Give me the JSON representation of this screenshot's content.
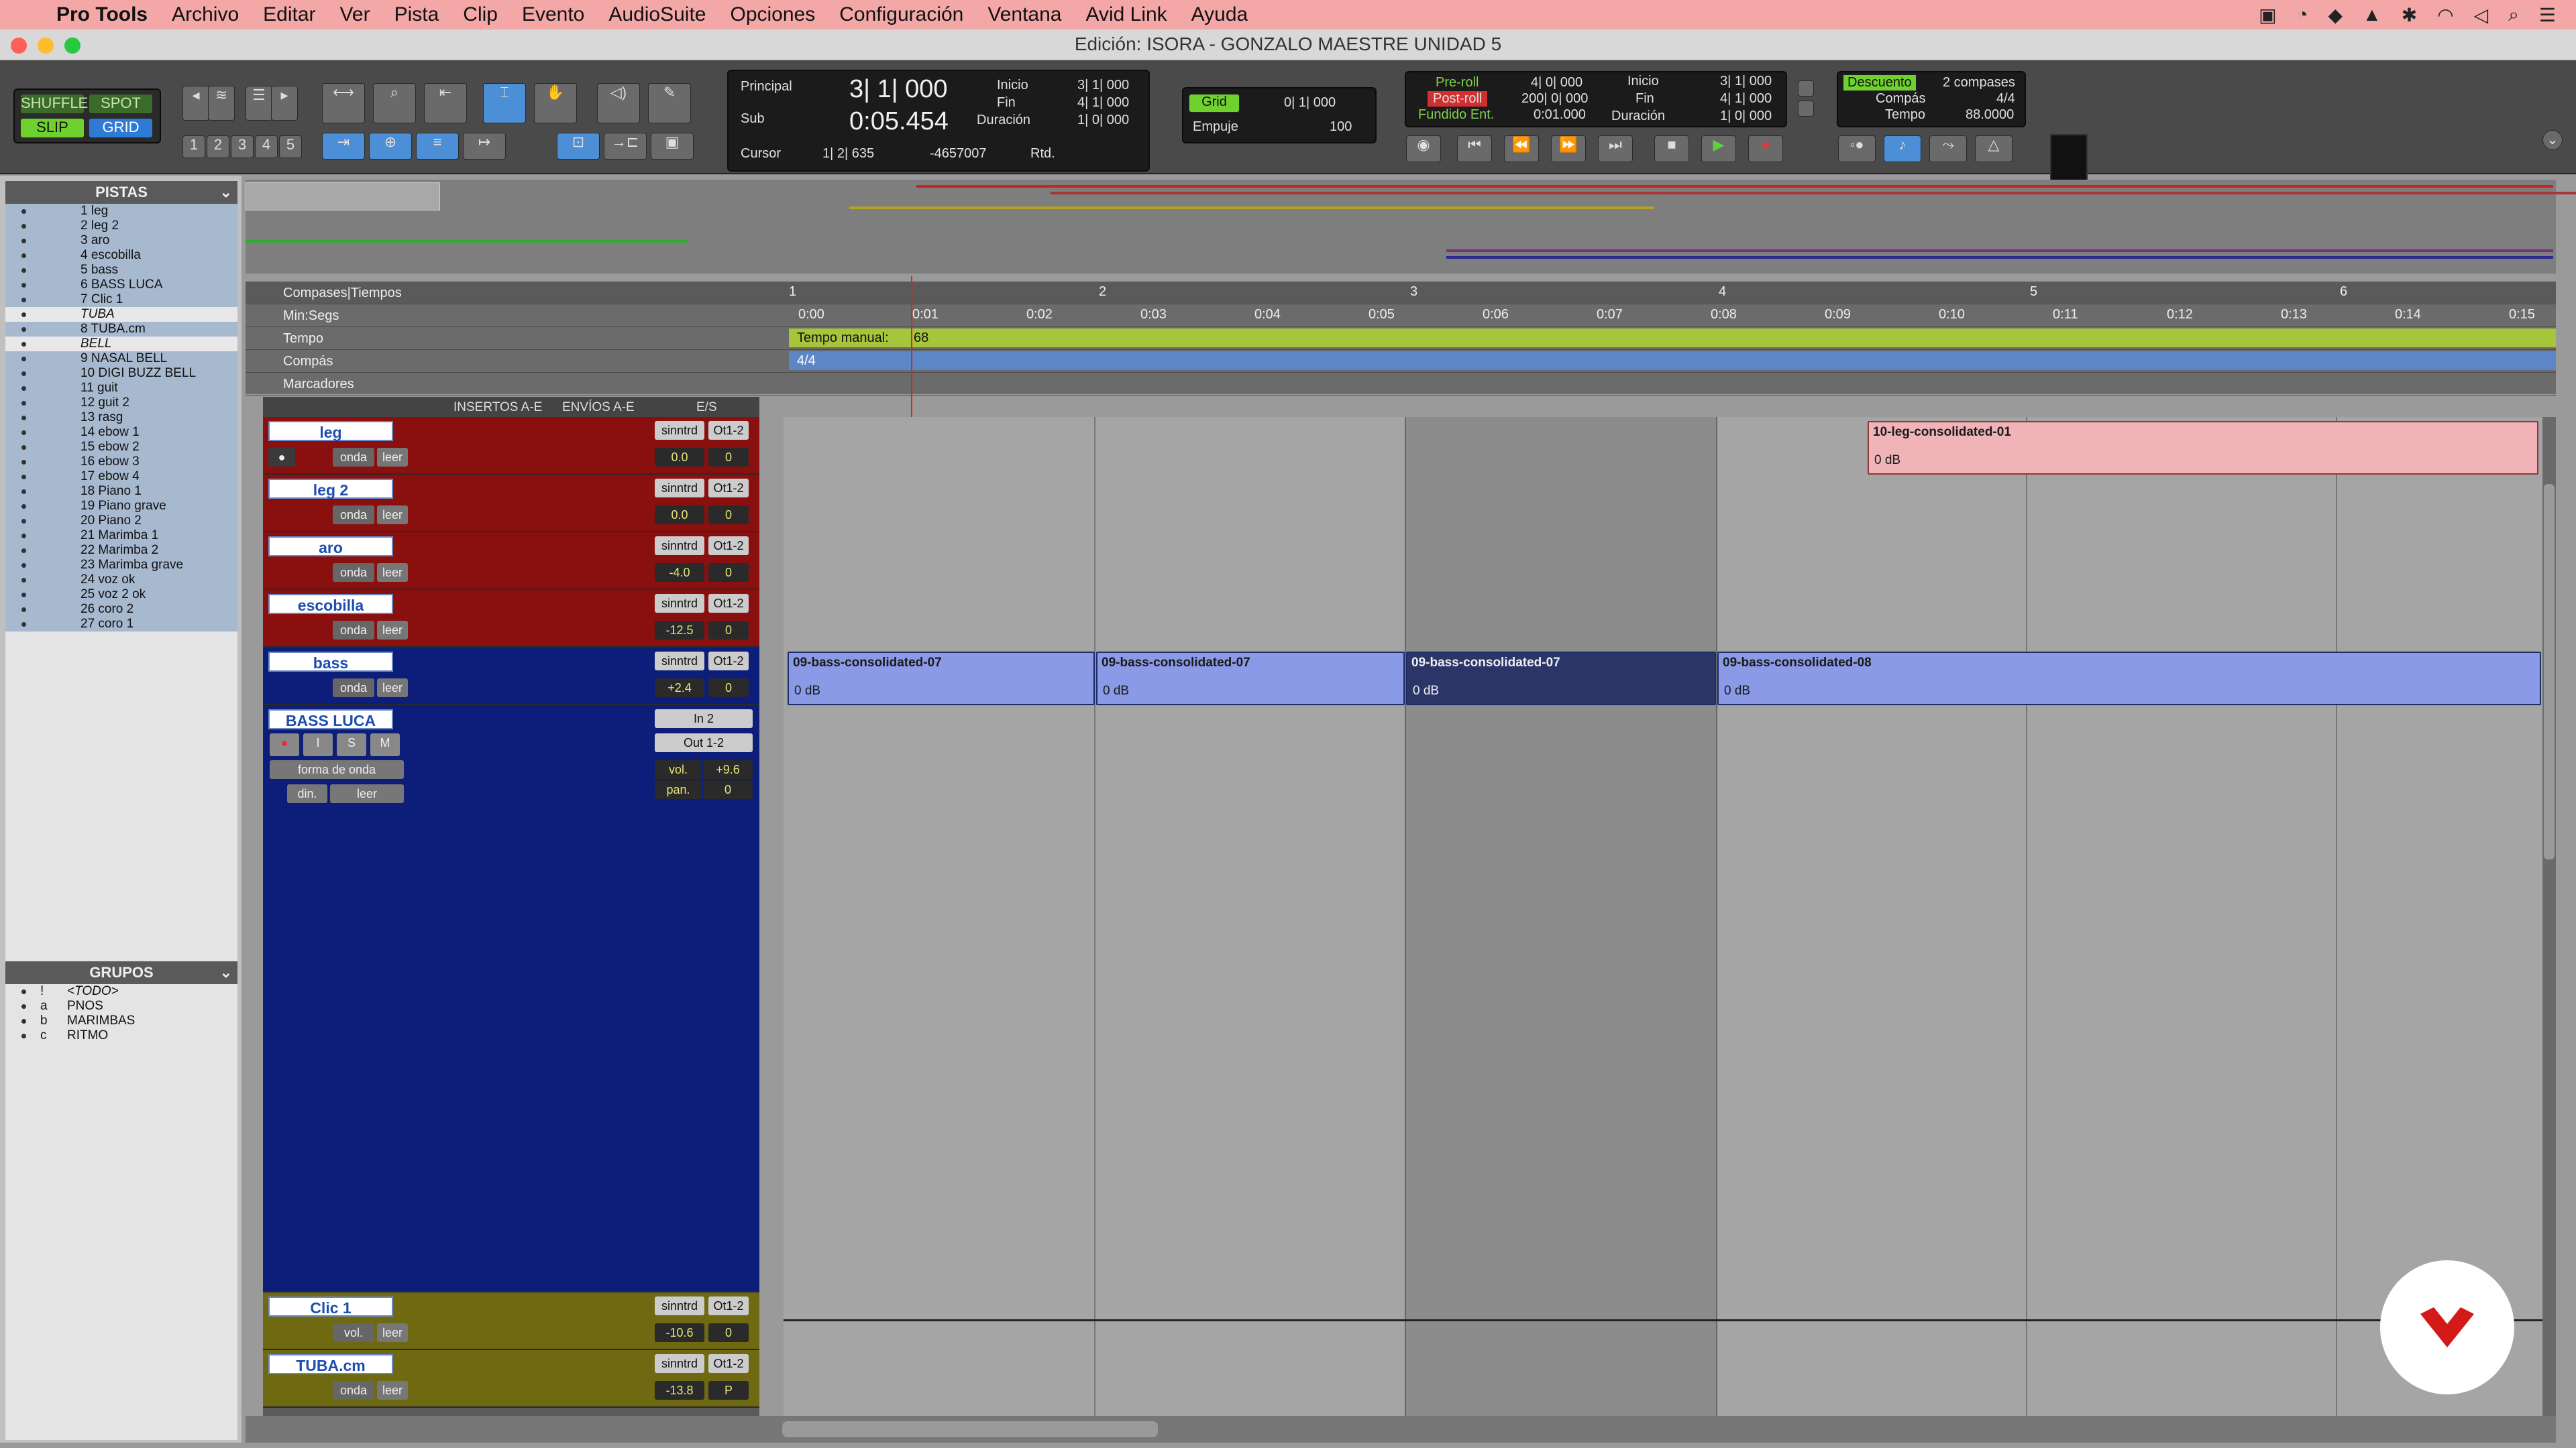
{
  "menubar": {
    "app": "Pro Tools",
    "items": [
      "Archivo",
      "Editar",
      "Ver",
      "Pista",
      "Clip",
      "Evento",
      "AudioSuite",
      "Opciones",
      "Configuración",
      "Ventana",
      "Avid Link",
      "Ayuda"
    ]
  },
  "window": {
    "title": "Edición: ISORA - GONZALO MAESTRE UNIDAD 5"
  },
  "edit_modes": {
    "shuffle": "SHUFFLE",
    "spot": "SPOT",
    "slip": "SLIP",
    "grid": "GRID"
  },
  "zoom_presets": [
    "1",
    "2",
    "3",
    "4",
    "5"
  ],
  "counter": {
    "principal_label": "Principal",
    "principal_value": "3| 1| 000",
    "sub_label": "Sub",
    "sub_value": "0:05.454",
    "inicio_label": "Inicio",
    "inicio_value": "3| 1| 000",
    "fin_label": "Fin",
    "fin_value": "4| 1| 000",
    "duracion_label": "Duración",
    "duracion_value": "1| 0| 000",
    "cursor_label": "Cursor",
    "cursor_value": "1| 2| 635",
    "cursor_sample": "-4657007",
    "rtd": "Rtd."
  },
  "grid": {
    "label": "Grid",
    "value": "0| 1| 000",
    "nudge_label": "Empuje",
    "nudge_value": "100"
  },
  "transport_counter": {
    "preroll_label": "Pre-roll",
    "preroll_value": "4| 0| 000",
    "postroll_label": "Post-roll",
    "postroll_value": "200| 0| 000",
    "fundido_label": "Fundido Ent.",
    "fundido_value": "0:01.000",
    "inicio_label": "Inicio",
    "inicio_value": "3| 1| 000",
    "fin_label": "Fin",
    "fin_value": "4| 1| 000",
    "duracion_label": "Duración",
    "duracion_value": "1| 0| 000"
  },
  "countoff": {
    "label": "Descuento",
    "value": "2 compases",
    "meter_label": "Compás",
    "meter_value": "4/4",
    "tempo_label": "Tempo",
    "tempo_value": "88.0000"
  },
  "tracks_panel": {
    "title": "PISTAS",
    "items": [
      "1 leg",
      "2 leg 2",
      "3 aro",
      "4 escobilla",
      "5 bass",
      "6 BASS LUCA",
      "7 Clic 1",
      "TUBA",
      "8 TUBA.cm",
      "BELL",
      "9 NASAL BELL",
      "10 DIGI BUZZ BELL",
      "11 guit",
      "12 guit 2",
      "13 rasg",
      "14 ebow 1",
      "15 ebow 2",
      "16 ebow 3",
      "17 ebow 4",
      "18 Piano 1",
      "19 Piano grave",
      "20 Piano 2",
      "21 Marimba 1",
      "22 Marimba 2",
      "23 Marimba grave",
      "24 voz ok",
      "25 voz 2 ok",
      "26 coro 2",
      "27 coro 1"
    ]
  },
  "groups_panel": {
    "title": "GRUPOS",
    "items": [
      {
        "id": "!",
        "name": "<TODO>"
      },
      {
        "id": "a",
        "name": "PNOS"
      },
      {
        "id": "b",
        "name": "MARIMBAS"
      },
      {
        "id": "c",
        "name": "RITMO"
      }
    ]
  },
  "rulers": {
    "bars_label": "Compases|Tiempos",
    "minsecs_label": "Min:Segs",
    "tempo_label": "Tempo",
    "meter_label": "Compás",
    "markers_label": "Marcadores",
    "tempo_text": "Tempo manual:",
    "tempo_value": "68",
    "meter_value": "4/4",
    "bars": [
      "1",
      "2",
      "3",
      "4",
      "5",
      "6"
    ],
    "times": [
      "0:00",
      "0:01",
      "0:02",
      "0:03",
      "0:04",
      "0:05",
      "0:06",
      "0:07",
      "0:08",
      "0:09",
      "0:10",
      "0:11",
      "0:12",
      "0:13",
      "0:14",
      "0:15"
    ]
  },
  "columns": {
    "inserts": "INSERTOS A-E",
    "sends": "ENVÍOS A-E",
    "io": "E/S"
  },
  "tracks": [
    {
      "name": "leg",
      "num": "1",
      "input": "sinntrd",
      "output": "Ot1-2",
      "vol": "0.0",
      "pan": "0"
    },
    {
      "name": "leg 2",
      "num": "2",
      "input": "sinntrd",
      "output": "Ot1-2",
      "vol": "0.0",
      "pan": "0"
    },
    {
      "name": "aro",
      "num": "3",
      "input": "sinntrd",
      "output": "Ot1-2",
      "vol": "-4.0",
      "pan": "0"
    },
    {
      "name": "escobilla",
      "num": "4",
      "input": "sinntrd",
      "output": "Ot1-2",
      "vol": "-12.5",
      "pan": "0"
    },
    {
      "name": "bass",
      "num": "5",
      "input": "sinntrd",
      "output": "Ot1-2",
      "vol": "+2.4",
      "pan": "0"
    },
    {
      "name": "BASS LUCA",
      "num": "6",
      "input": "In 2",
      "output": "Out 1-2",
      "vol_label": "vol.",
      "vol": "+9.6",
      "pan_label": "pan.",
      "pan": "0",
      "view": "forma de onda",
      "auto_label": "din.",
      "auto_mode": "leer"
    },
    {
      "name": "Clic 1",
      "num": "7",
      "input": "sinntrd",
      "output": "Ot1-2",
      "vol": "-10.6",
      "pan": "0"
    },
    {
      "name": "TUBA.cm",
      "num": "8",
      "input": "sinntrd",
      "output": "Ot1-2",
      "vol": "-13.8",
      "pan": "P"
    }
  ],
  "track_controls": {
    "rec": "●",
    "input": "I",
    "solo": "S",
    "mute": "M",
    "view": "onda",
    "auto": "leer",
    "clic_view": "vol."
  },
  "clips": {
    "leg_clip": "10-leg-consolidated-01",
    "bass_clips": [
      "09-bass-consolidated-07",
      "09-bass-consolidated-07",
      "09-bass-consolidated-07",
      "09-bass-consolidated-08"
    ],
    "gain": "0 dB"
  },
  "colors": {
    "menubar": "#f3a7a7",
    "track_red": "#8a1010",
    "track_blue": "#0d1e7a",
    "track_yellow": "#6f6a12",
    "clip_red": "#efb3b8",
    "clip_blue": "#8b9ae6",
    "selection": "#8c8c8c"
  }
}
